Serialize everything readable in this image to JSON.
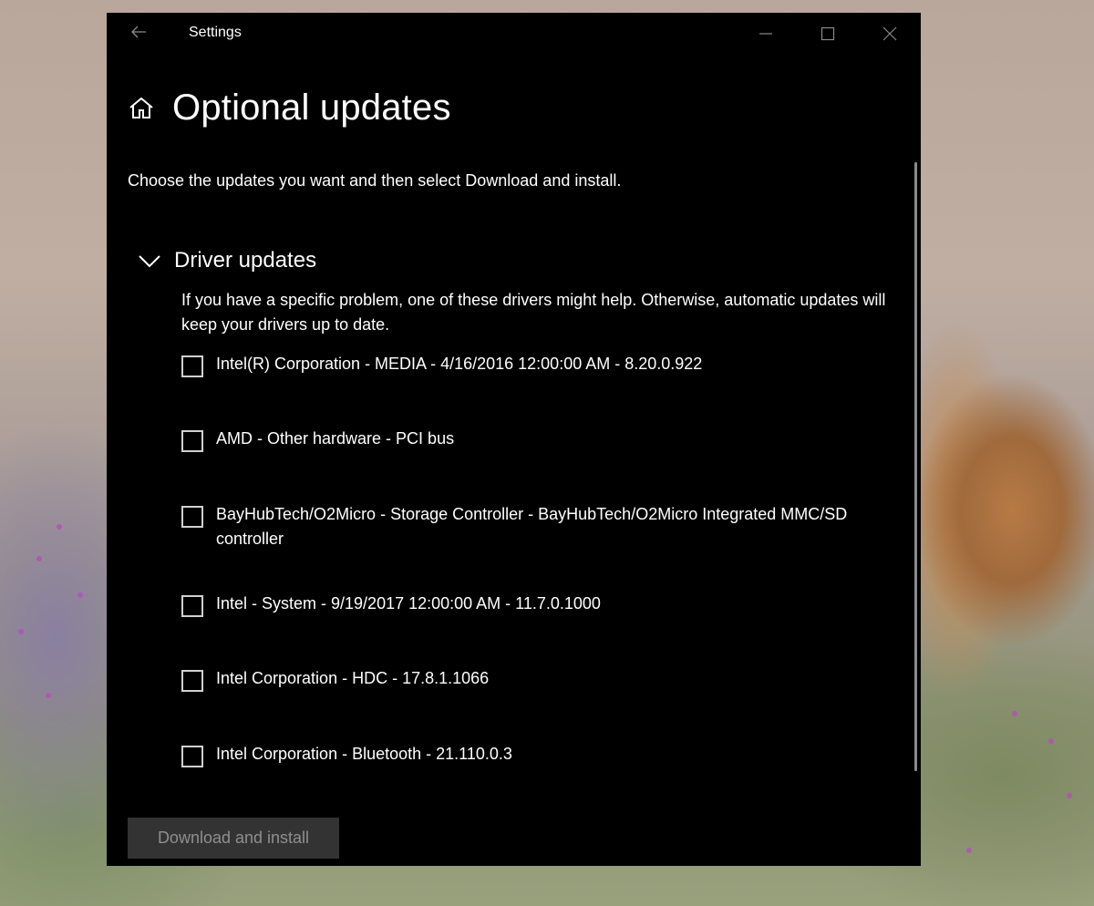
{
  "window": {
    "title": "Settings",
    "back_icon": "arrow-left-icon",
    "controls": [
      "minimize-icon",
      "maximize-icon",
      "close-icon"
    ]
  },
  "page": {
    "title": "Optional updates",
    "home_icon": "home-icon",
    "intro": "Choose the updates you want and then select Download and install."
  },
  "driver_section": {
    "title": "Driver updates",
    "expanded": true,
    "description": "If you have a specific problem, one of these drivers might help. Otherwise, automatic updates will keep your drivers up to date.",
    "items": [
      {
        "label": "Intel(R) Corporation - MEDIA - 4/16/2016 12:00:00 AM - 8.20.0.922",
        "checked": false
      },
      {
        "label": "AMD - Other hardware - PCI bus",
        "checked": false
      },
      {
        "label": "BayHubTech/O2Micro - Storage Controller - BayHubTech/O2Micro Integrated MMC/SD controller",
        "checked": false
      },
      {
        "label": "Intel - System - 9/19/2017 12:00:00 AM - 11.7.0.1000",
        "checked": false
      },
      {
        "label": "Intel Corporation - HDC - 17.8.1.1066",
        "checked": false
      },
      {
        "label": "Intel Corporation - Bluetooth - 21.110.0.3",
        "checked": false
      }
    ]
  },
  "actions": {
    "download_label": "Download and install",
    "download_enabled": false
  },
  "colors": {
    "window_bg": "#000000",
    "text": "#ffffff",
    "disabled_button_bg": "#333333",
    "disabled_button_text": "#8f8f8f",
    "chrome_icons": "#8a8a8a"
  }
}
